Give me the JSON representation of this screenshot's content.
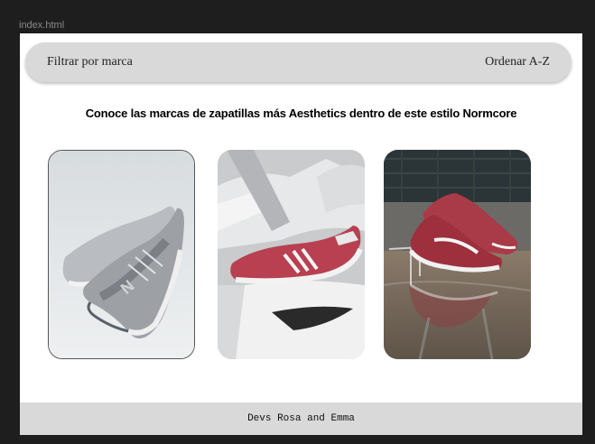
{
  "window": {
    "tab_title": "index.html"
  },
  "topbar": {
    "filter_label": "Filtrar por marca",
    "sort_label": "Ordenar A-Z"
  },
  "main": {
    "heading": "Conoce las marcas de zapatillas más Aesthetics dentro de este estilo Normcore",
    "cards": [
      {
        "image": "grey-new-balance-sneakers-photo"
      },
      {
        "image": "red-adidas-and-white-nike-sneakers-photo"
      },
      {
        "image": "red-puma-suede-sneakers-puddle-photo"
      }
    ]
  },
  "footer": {
    "credit": "Devs Rosa and Emma"
  }
}
